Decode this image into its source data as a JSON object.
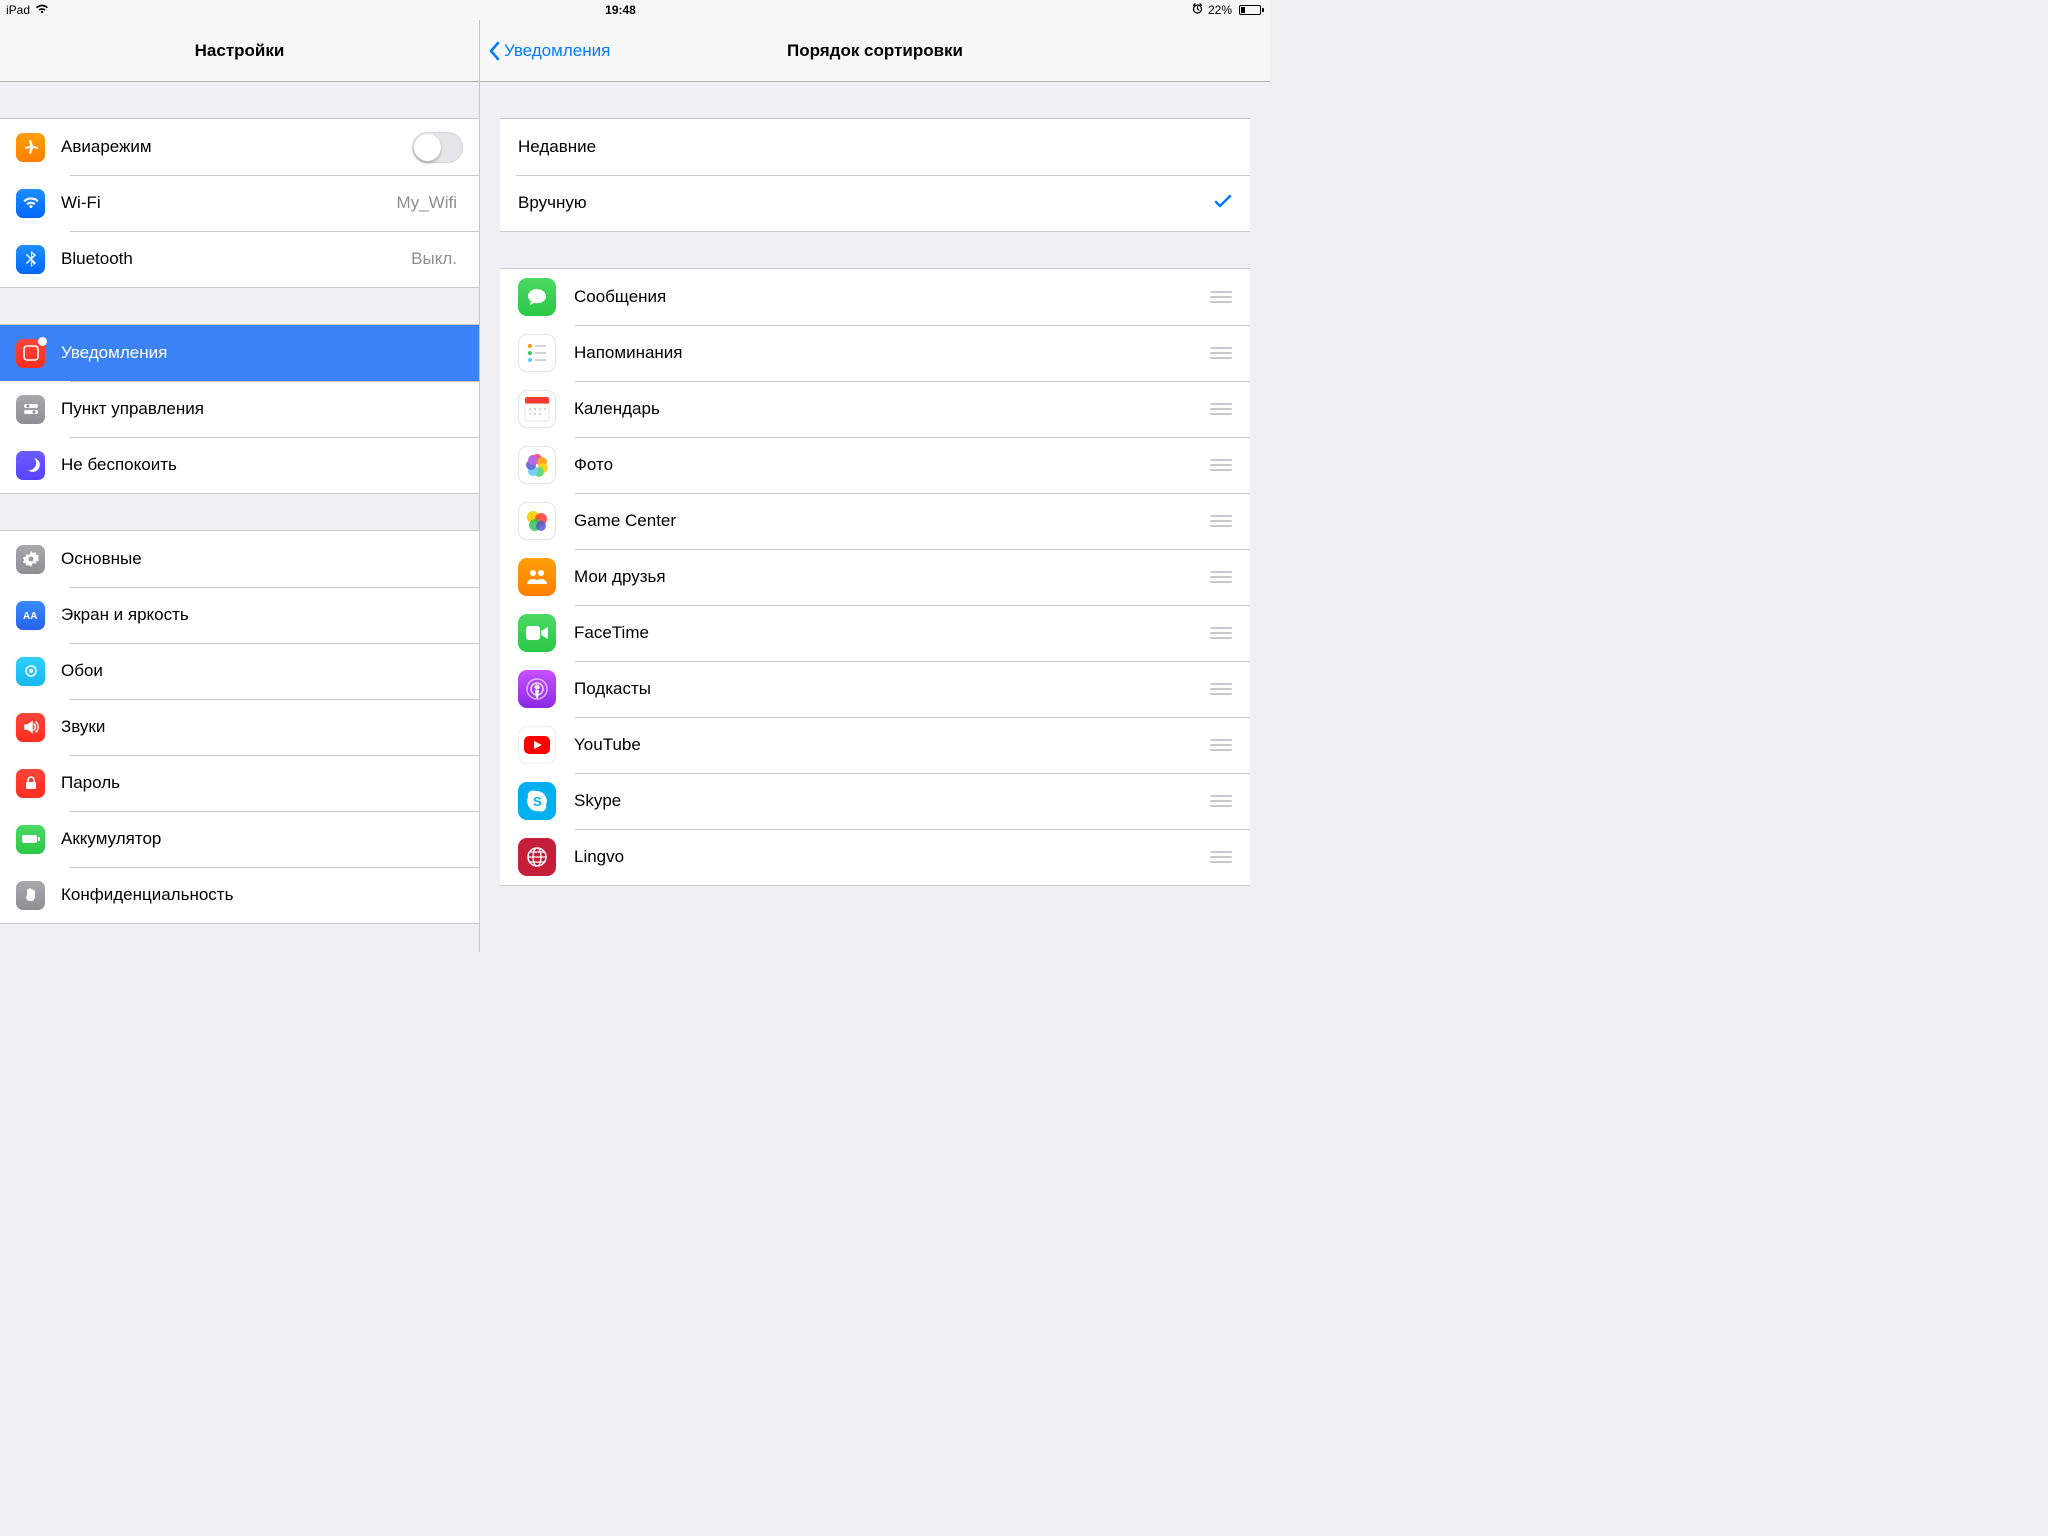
{
  "status": {
    "device": "iPad",
    "time": "19:48",
    "battery": "22%"
  },
  "sidebar": {
    "title": "Настройки",
    "g1": [
      {
        "label": "Авиарежим",
        "type": "toggle"
      },
      {
        "label": "Wi-Fi",
        "value": "My_Wifi"
      },
      {
        "label": "Bluetooth",
        "value": "Выкл."
      }
    ],
    "g2": [
      {
        "label": "Уведомления",
        "selected": true
      },
      {
        "label": "Пункт управления"
      },
      {
        "label": "Не беспокоить"
      }
    ],
    "g3": [
      {
        "label": "Основные"
      },
      {
        "label": "Экран и яркость"
      },
      {
        "label": "Обои"
      },
      {
        "label": "Звуки"
      },
      {
        "label": "Пароль"
      },
      {
        "label": "Аккумулятор"
      },
      {
        "label": "Конфиденциальность"
      }
    ]
  },
  "detail": {
    "back": "Уведомления",
    "title": "Порядок сортировки",
    "options": [
      {
        "label": "Недавние",
        "checked": false
      },
      {
        "label": "Вручную",
        "checked": true
      }
    ],
    "apps": [
      {
        "label": "Сообщения"
      },
      {
        "label": "Напоминания"
      },
      {
        "label": "Календарь"
      },
      {
        "label": "Фото"
      },
      {
        "label": "Game Center"
      },
      {
        "label": "Мои друзья"
      },
      {
        "label": "FaceTime"
      },
      {
        "label": "Подкасты"
      },
      {
        "label": "YouTube"
      },
      {
        "label": "Skype"
      },
      {
        "label": "Lingvo"
      }
    ]
  }
}
